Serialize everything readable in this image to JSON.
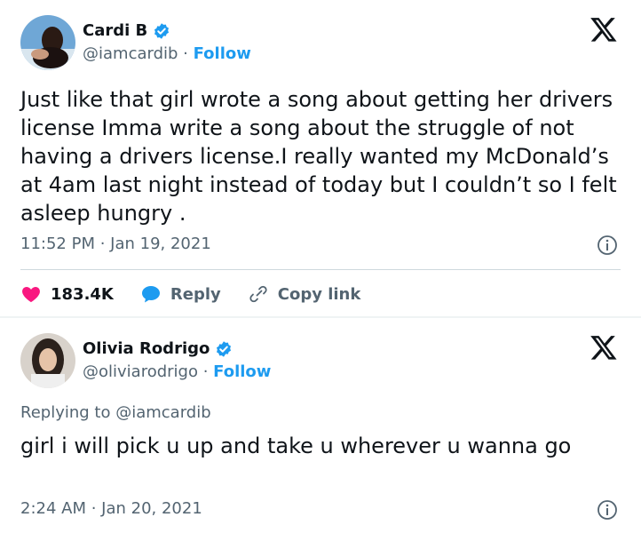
{
  "tweets": [
    {
      "author": {
        "name": "Cardi B",
        "handle": "@iamcardib"
      },
      "follow_label": "Follow",
      "separator": " · ",
      "text": "Just like that girl wrote a song about getting her drivers license Imma write a song about the struggle of not having a drivers license.I really wanted my McDonald’s at 4am last night instead of today but I couldn’t so I felt asleep hungry .",
      "timestamp": "11:52 PM · Jan 19, 2021",
      "actions": {
        "likes": "183.4K",
        "reply_label": "Reply",
        "copy_label": "Copy link"
      }
    },
    {
      "author": {
        "name": "Olivia Rodrigo",
        "handle": "@oliviarodrigo"
      },
      "follow_label": "Follow",
      "separator": " · ",
      "replying_to": "Replying to @iamcardib",
      "text": "girl i will pick u up and take u wherever u wanna go",
      "timestamp": "2:24 AM · Jan 20, 2021"
    }
  ],
  "colors": {
    "link_blue": "#1d9bf0",
    "like_pink": "#f91880",
    "secondary_text": "#536471",
    "primary_text": "#0f1419"
  },
  "icons": [
    "verified-badge-icon",
    "x-logo-icon",
    "info-icon",
    "heart-icon",
    "reply-bubble-icon",
    "link-icon"
  ]
}
